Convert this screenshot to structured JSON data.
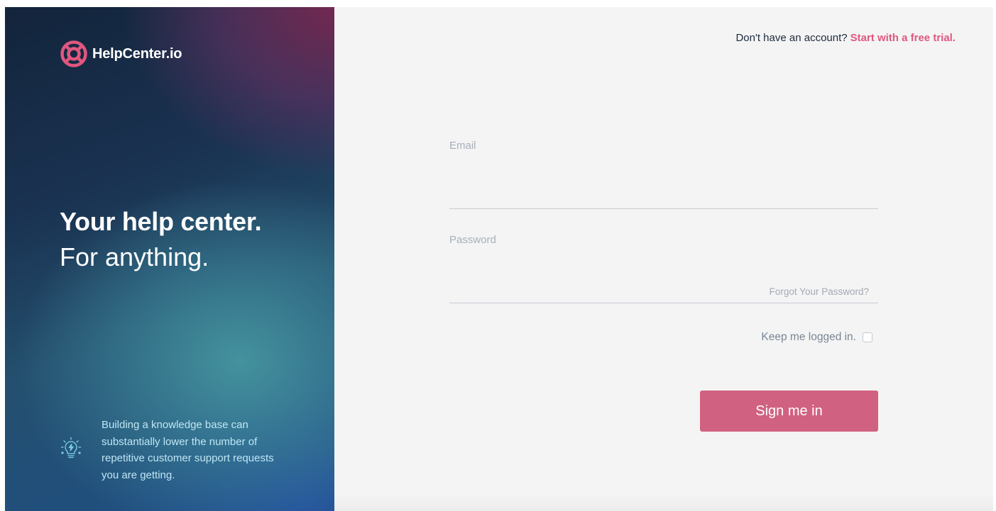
{
  "brand": {
    "name": "HelpCenter.io",
    "logo_icon": "lifebuoy-icon",
    "accent_color": "#e0577f"
  },
  "hero": {
    "headline": "Your help center.",
    "subline": "For anything."
  },
  "tip": {
    "icon": "lightbulb-icon",
    "text": "Building a knowledge base can substantially lower the number of repetitive customer support requests you are getting."
  },
  "header": {
    "prompt": "Don't have an account?",
    "trial_link": "Start with a free trial."
  },
  "form": {
    "email_label": "Email",
    "email_value": "",
    "password_label": "Password",
    "password_value": "",
    "forgot_link": "Forgot Your Password?",
    "keep_logged_in_label": "Keep me logged in.",
    "keep_logged_in_checked": false,
    "submit_label": "Sign me in",
    "submit_color": "#d16181"
  }
}
